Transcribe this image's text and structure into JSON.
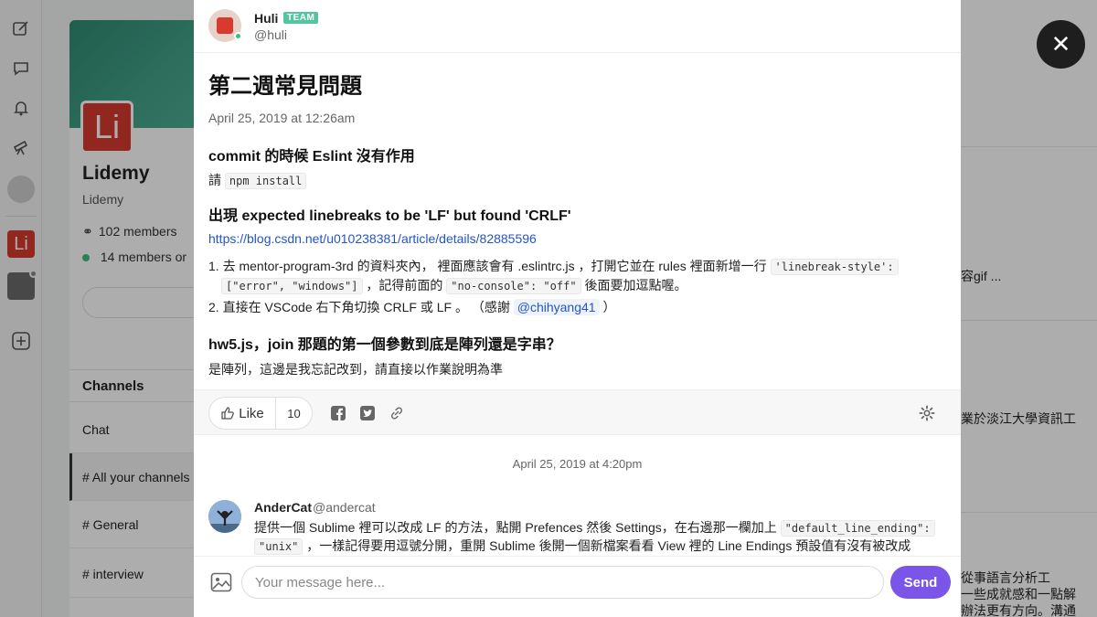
{
  "community": {
    "logo_text": "Li",
    "name": "Lidemy",
    "subtitle": "Lidemy",
    "members": "102 members",
    "online": "14 members or",
    "section": "Channels",
    "channels": [
      "Chat",
      "# All your channels",
      "# General",
      "# interview"
    ]
  },
  "rail": {
    "logo_text": "Li"
  },
  "right_bg": {
    "lines": [
      "容gif ...",
      "業於淡江大學資訊工",
      "從事語言分析工",
      "一些成就感和一點解",
      "辦法更有方向。溝通"
    ]
  },
  "post": {
    "author_name": "Huli",
    "team_badge": "TEAM",
    "author_handle": "@huli",
    "title": "第二週常見問題",
    "date": "April 25, 2019 at 12:26am",
    "s1_title": "commit 的時候 Eslint 沒有作用",
    "s1_prefix": "請",
    "s1_code": "npm install",
    "s2_title": "出現 expected linebreaks to be 'LF' but found 'CRLF'",
    "s2_link": "https://blog.csdn.net/u010238381/article/details/82885596",
    "li1_a": "1. 去 mentor-program-3rd 的資料夾內， 裡面應該會有 .eslintrc.js ，打開它並在 rules 裡面新增一行",
    "li1_code1": "'linebreak-style':",
    "li1_code2": "[\"error\", \"windows\"]",
    "li1_b": "，記得前面的",
    "li1_code3": "\"no-console\": \"off\"",
    "li1_c": "後面要加逗點喔。",
    "li2_a": "2. 直接在 VSCode 右下角切換 CRLF 或 LF 。 （感謝",
    "li2_mention": "@chihyang41",
    "li2_b": "）",
    "s3_title": "hw5.js，join 那題的第一個參數到底是陣列還是字串？",
    "s3_body": "是陣列，這邊是我忘記改到，請直接以作業說明為準"
  },
  "actions": {
    "like_label": "Like",
    "like_count": "10"
  },
  "reply": {
    "date_divider": "April 25, 2019 at 4:20pm",
    "name": "AnderCat",
    "handle": "@andercat",
    "line1_a": "提供一個 Sublime 裡可以改成 LF 的方法，點開 Prefences 然後 Settings，在右邊那一欄加上",
    "line1_code": "\"default_line_ending\":",
    "line2_code": "\"unix\"",
    "line2_a": "，一樣記得要用逗號分開，重開 Sublime 後開一個新檔案看看 View 裡的 Line Endings 預設值有沒有被改成"
  },
  "composer": {
    "placeholder": "Your message here...",
    "send_label": "Send"
  },
  "colors": {
    "accent": "#7b54e8",
    "team_badge": "#55c5a1",
    "link": "#2355c8",
    "brand_red": "#d83a2e"
  }
}
